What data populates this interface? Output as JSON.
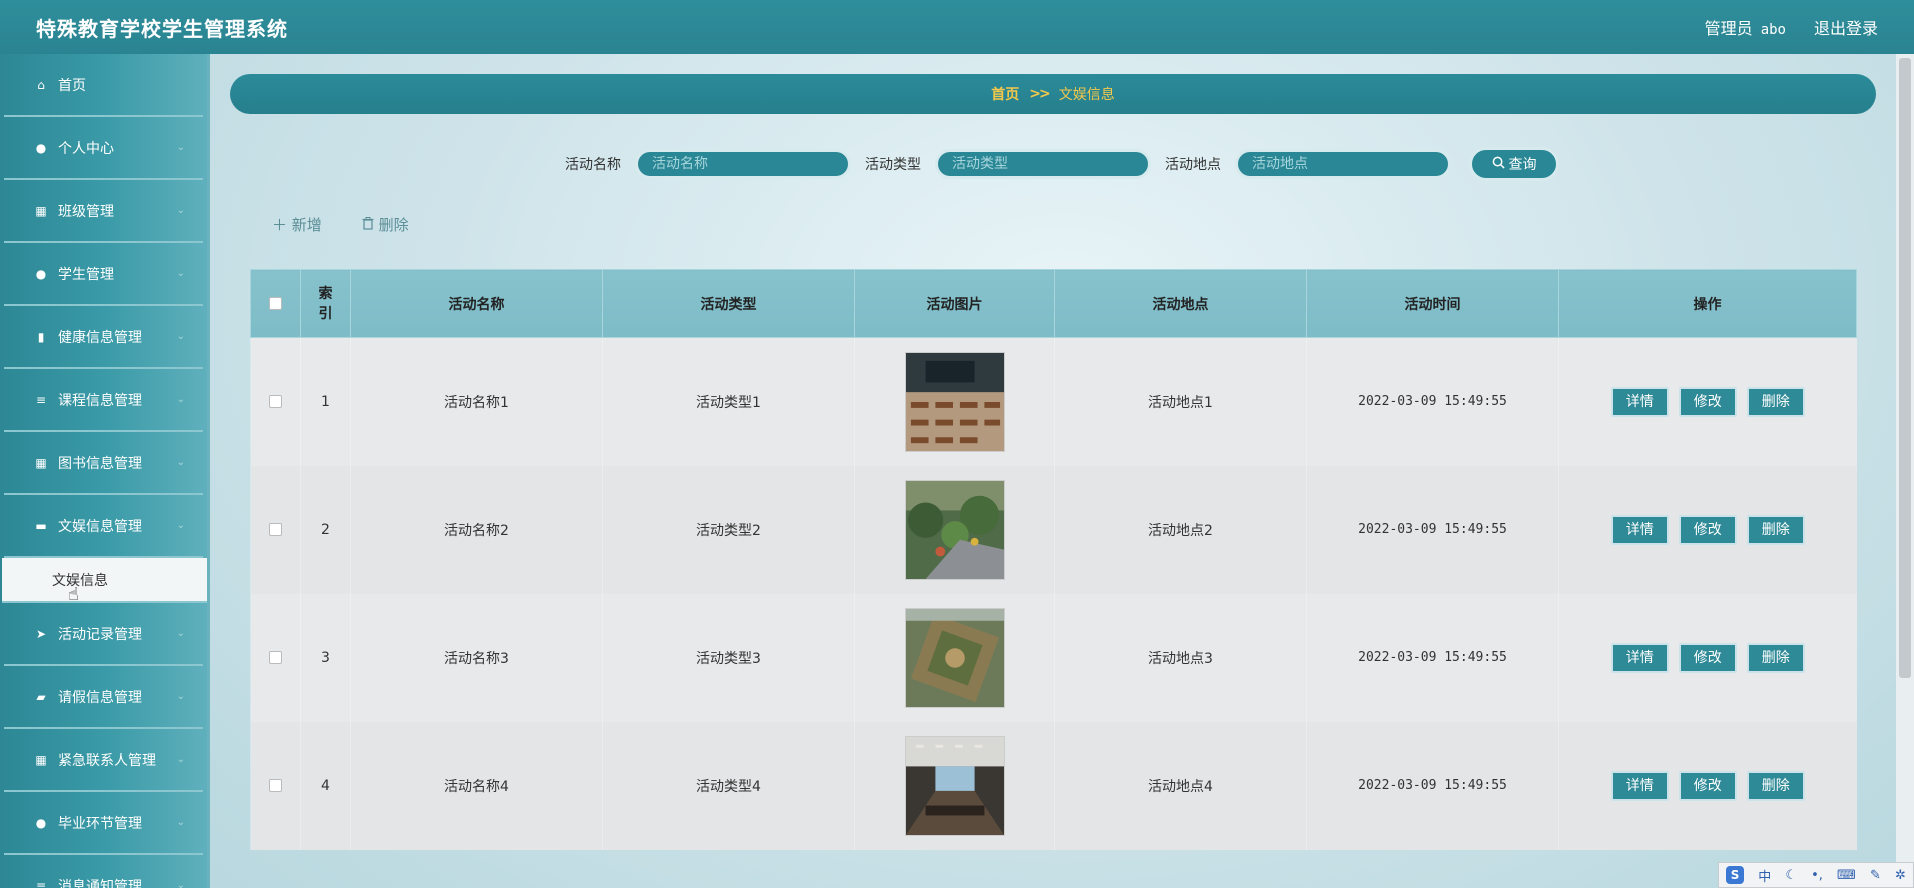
{
  "header": {
    "title": "特殊教育学校学生管理系统",
    "role_label": "管理员",
    "username": "abo",
    "logout_label": "退出登录"
  },
  "sidebar": {
    "items": [
      {
        "label": "首页",
        "icon": "home-icon",
        "glyph": "⌂",
        "has_children": false
      },
      {
        "label": "个人中心",
        "icon": "user-icon",
        "glyph": "●",
        "has_children": true
      },
      {
        "label": "班级管理",
        "icon": "grid-icon",
        "glyph": "▦",
        "has_children": true
      },
      {
        "label": "学生管理",
        "icon": "user-icon",
        "glyph": "●",
        "has_children": true
      },
      {
        "label": "健康信息管理",
        "icon": "bar-chart-icon",
        "glyph": "▮",
        "has_children": true
      },
      {
        "label": "课程信息管理",
        "icon": "list-icon",
        "glyph": "≡",
        "has_children": true
      },
      {
        "label": "图书信息管理",
        "icon": "grid-icon",
        "glyph": "▦",
        "has_children": true
      },
      {
        "label": "文娱信息管理",
        "icon": "monitor-icon",
        "glyph": "▬",
        "has_children": true
      },
      {
        "label": "活动记录管理",
        "icon": "send-icon",
        "glyph": "➤",
        "has_children": true
      },
      {
        "label": "请假信息管理",
        "icon": "ticket-icon",
        "glyph": "▰",
        "has_children": true
      },
      {
        "label": "紧急联系人管理",
        "icon": "grid-icon",
        "glyph": "▦",
        "has_children": true
      },
      {
        "label": "毕业环节管理",
        "icon": "user-icon",
        "glyph": "●",
        "has_children": true
      },
      {
        "label": "消息通知管理",
        "icon": "list-icon",
        "glyph": "≡",
        "has_children": true
      }
    ],
    "active_submenu": "文娱信息"
  },
  "breadcrumb": {
    "home": "首页",
    "separator": ">>",
    "current": "文娱信息"
  },
  "search": {
    "name_label": "活动名称",
    "name_placeholder": "活动名称",
    "type_label": "活动类型",
    "type_placeholder": "活动类型",
    "place_label": "活动地点",
    "place_placeholder": "活动地点",
    "query_label": "查询"
  },
  "actions": {
    "add_label": "新增",
    "delete_label": "删除"
  },
  "table": {
    "headers": {
      "index": "索引",
      "name": "活动名称",
      "type": "活动类型",
      "image": "活动图片",
      "place": "活动地点",
      "time": "活动时间",
      "ops": "操作"
    },
    "rows": [
      {
        "index": "1",
        "name": "活动名称1",
        "type": "活动类型1",
        "place": "活动地点1",
        "time": "2022-03-09 15:49:55"
      },
      {
        "index": "2",
        "name": "活动名称2",
        "type": "活动类型2",
        "place": "活动地点2",
        "time": "2022-03-09 15:49:55"
      },
      {
        "index": "3",
        "name": "活动名称3",
        "type": "活动类型3",
        "place": "活动地点3",
        "time": "2022-03-09 15:49:55"
      },
      {
        "index": "4",
        "name": "活动名称4",
        "type": "活动类型4",
        "place": "活动地点4",
        "time": "2022-03-09 15:49:55"
      }
    ],
    "op_labels": {
      "detail": "详情",
      "edit": "修改",
      "delete": "删除"
    }
  },
  "ime": {
    "mode": "中"
  },
  "colors": {
    "primary": "#2a8795",
    "accent": "#f3c84b"
  }
}
